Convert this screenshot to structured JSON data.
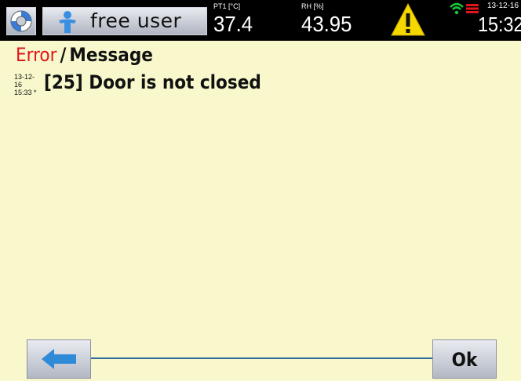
{
  "header": {
    "user_name": "free user",
    "sensor1": {
      "label": "PT1 [°C]",
      "value": "37.4"
    },
    "sensor2": {
      "label": "RH [%]",
      "value": "43.95"
    },
    "date": "13-12-16",
    "time": "15:32",
    "icons": [
      "lifebuoy-icon",
      "user-icon",
      "warning-icon",
      "wifi-icon",
      "battery-icon"
    ],
    "status_colors": {
      "wifi": "#18c83a",
      "battery": "#e0161b",
      "warning": "#f5d800"
    }
  },
  "page": {
    "title_error": "Error",
    "title_sep": "/",
    "title_message": "Message"
  },
  "messages": [
    {
      "date": "13-12-16",
      "time": "15:33",
      "flag": "*",
      "text": "[25] Door is not closed"
    }
  ],
  "footer": {
    "back_icon": "arrow-left-icon",
    "ok_label": "Ok"
  }
}
